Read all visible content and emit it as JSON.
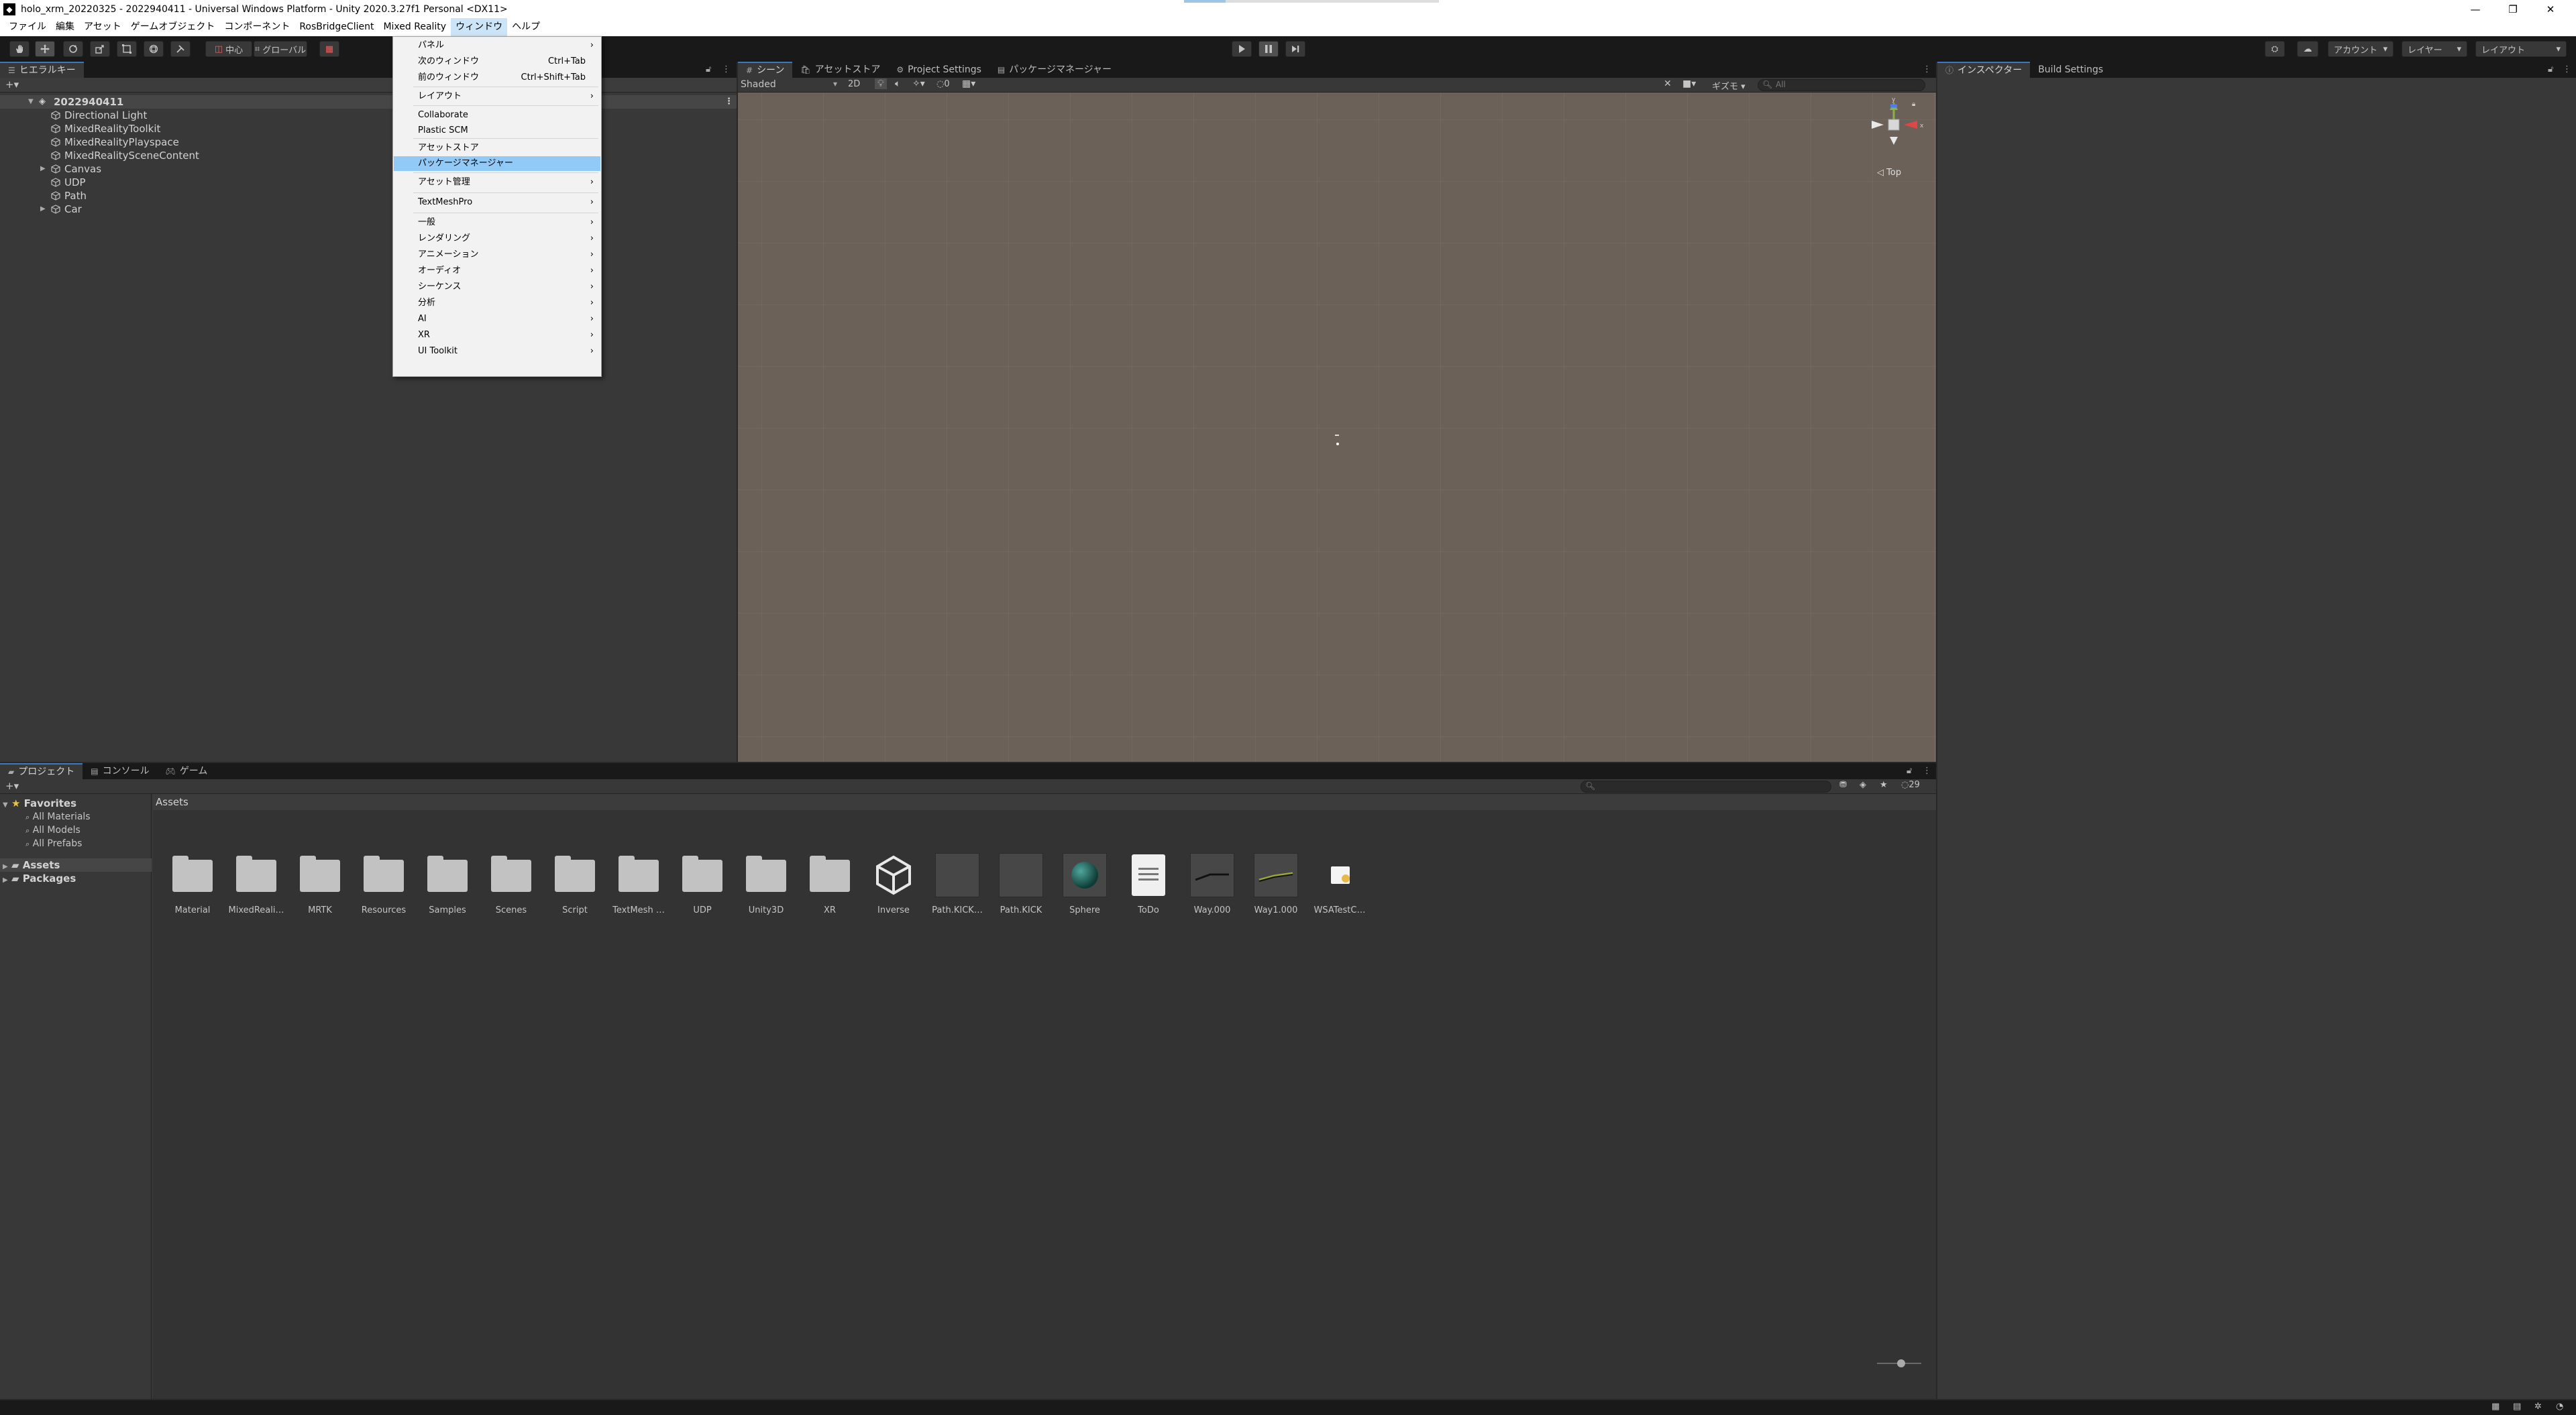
{
  "window": {
    "title": "holo_xrm_20220325 - 2022940411 - Universal Windows Platform - Unity 2020.3.27f1 Personal <DX11>",
    "minimize": "—",
    "restore": "❐",
    "close": "✕"
  },
  "menubar": [
    "ファイル",
    "編集",
    "アセット",
    "ゲームオブジェクト",
    "コンポーネント",
    "RosBridgeClient",
    "Mixed Reality",
    "ウィンドウ",
    "ヘルプ"
  ],
  "toolbar": {
    "pivot": "中心",
    "global": "グローバル",
    "account": "アカウント",
    "layers": "レイヤー",
    "layout": "レイアウト"
  },
  "hierarchy": {
    "tab": "ヒエラルキー",
    "add": "+▾",
    "scene": "2022940411",
    "items": [
      "Directional Light",
      "MixedRealityToolkit",
      "MixedRealityPlayspace",
      "MixedRealitySceneContent",
      "Canvas",
      "UDP",
      "Path",
      "Car"
    ]
  },
  "scene_tabs": [
    "シーン",
    "アセットストア",
    "Project Settings",
    "パッケージマネージャー"
  ],
  "scene_toolbar": {
    "shading": "Shaded",
    "mode2d": "2D",
    "gizmos": "ギズモ",
    "search_placeholder": "All",
    "layers_count": "0"
  },
  "scene_gizmo": {
    "label": "◁ Top",
    "y": "y",
    "x": "x",
    "z": "z"
  },
  "inspector_tabs": [
    "インスペクター",
    "Build Settings"
  ],
  "project": {
    "tabs": [
      "プロジェクト",
      "コンソール",
      "ゲーム"
    ],
    "favorites": "Favorites",
    "favorite_items": [
      "All Materials",
      "All Models",
      "All Prefabs"
    ],
    "roots": [
      "Assets",
      "Packages"
    ],
    "breadcrumb": "Assets",
    "hidden_count": "29",
    "assets": [
      {
        "name": "Material",
        "kind": "folder"
      },
      {
        "name": "MixedReali…",
        "kind": "folder"
      },
      {
        "name": "MRTK",
        "kind": "folder"
      },
      {
        "name": "Resources",
        "kind": "folder"
      },
      {
        "name": "Samples",
        "kind": "folder"
      },
      {
        "name": "Scenes",
        "kind": "folder"
      },
      {
        "name": "Script",
        "kind": "folder"
      },
      {
        "name": "TextMesh …",
        "kind": "folder"
      },
      {
        "name": "UDP",
        "kind": "folder"
      },
      {
        "name": "Unity3D",
        "kind": "folder"
      },
      {
        "name": "XR",
        "kind": "folder"
      },
      {
        "name": "Inverse",
        "kind": "unity-logo"
      },
      {
        "name": "Path.KICK…",
        "kind": "dark"
      },
      {
        "name": "Path.KICK",
        "kind": "dark"
      },
      {
        "name": "Sphere",
        "kind": "sphere"
      },
      {
        "name": "ToDo",
        "kind": "doc"
      },
      {
        "name": "Way.000",
        "kind": "line"
      },
      {
        "name": "Way1.000",
        "kind": "line2"
      },
      {
        "name": "WSATestC…",
        "kind": "cert"
      }
    ]
  },
  "window_menu": {
    "items": [
      {
        "label": "パネル",
        "sub": true
      },
      {
        "label": "次のウィンドウ",
        "shortcut": "Ctrl+Tab"
      },
      {
        "label": "前のウィンドウ",
        "shortcut": "Ctrl+Shift+Tab"
      },
      {
        "label": "レイアウト",
        "sub": true
      },
      {
        "label": "Collaborate"
      },
      {
        "label": "Plastic SCM"
      },
      {
        "label": "アセットストア"
      },
      {
        "label": "パッケージマネージャー",
        "highlight": true
      },
      {
        "label": "アセット管理",
        "sub": true
      },
      {
        "label": "TextMeshPro",
        "sub": true
      },
      {
        "label": "一般",
        "sub": true
      },
      {
        "label": "レンダリング",
        "sub": true
      },
      {
        "label": "アニメーション",
        "sub": true
      },
      {
        "label": "オーディオ",
        "sub": true
      },
      {
        "label": "シーケンス",
        "sub": true
      },
      {
        "label": "分析",
        "sub": true
      },
      {
        "label": "AI",
        "sub": true
      },
      {
        "label": "XR",
        "sub": true
      },
      {
        "label": "UI Toolkit",
        "sub": true
      }
    ]
  },
  "colors": {
    "accent": "#3a79bb",
    "menu_highlight": "#91c9f7",
    "scene_bg": "#6b6159"
  }
}
